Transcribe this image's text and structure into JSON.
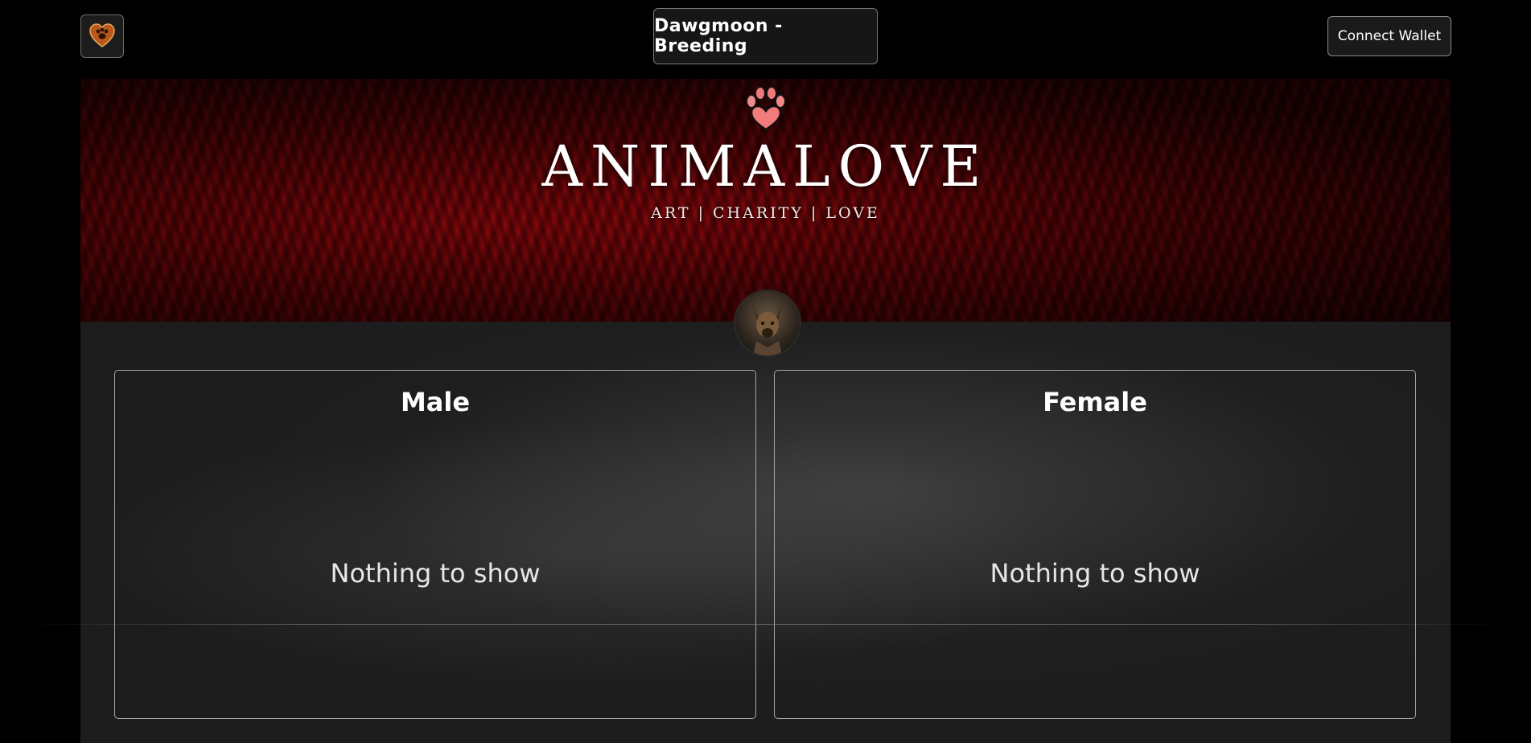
{
  "header": {
    "logo_icon": "heart-paw-logo-icon",
    "title": "Dawgmoon - Breeding",
    "connect_wallet_label": "Connect Wallet"
  },
  "banner": {
    "brand_title": "ANIMALOVE",
    "brand_subtitle": "ART | CHARITY | LOVE",
    "logo_icon": "paw-heart-icon",
    "avatar_icon": "dog-avatar"
  },
  "panels": [
    {
      "title": "Male",
      "empty_text": "Nothing to show"
    },
    {
      "title": "Female",
      "empty_text": "Nothing to show"
    }
  ],
  "colors": {
    "background": "#000000",
    "panel_background": "#1d1c1d",
    "banner_red": "#b3060b",
    "panel_border": "#a7a7a7"
  }
}
